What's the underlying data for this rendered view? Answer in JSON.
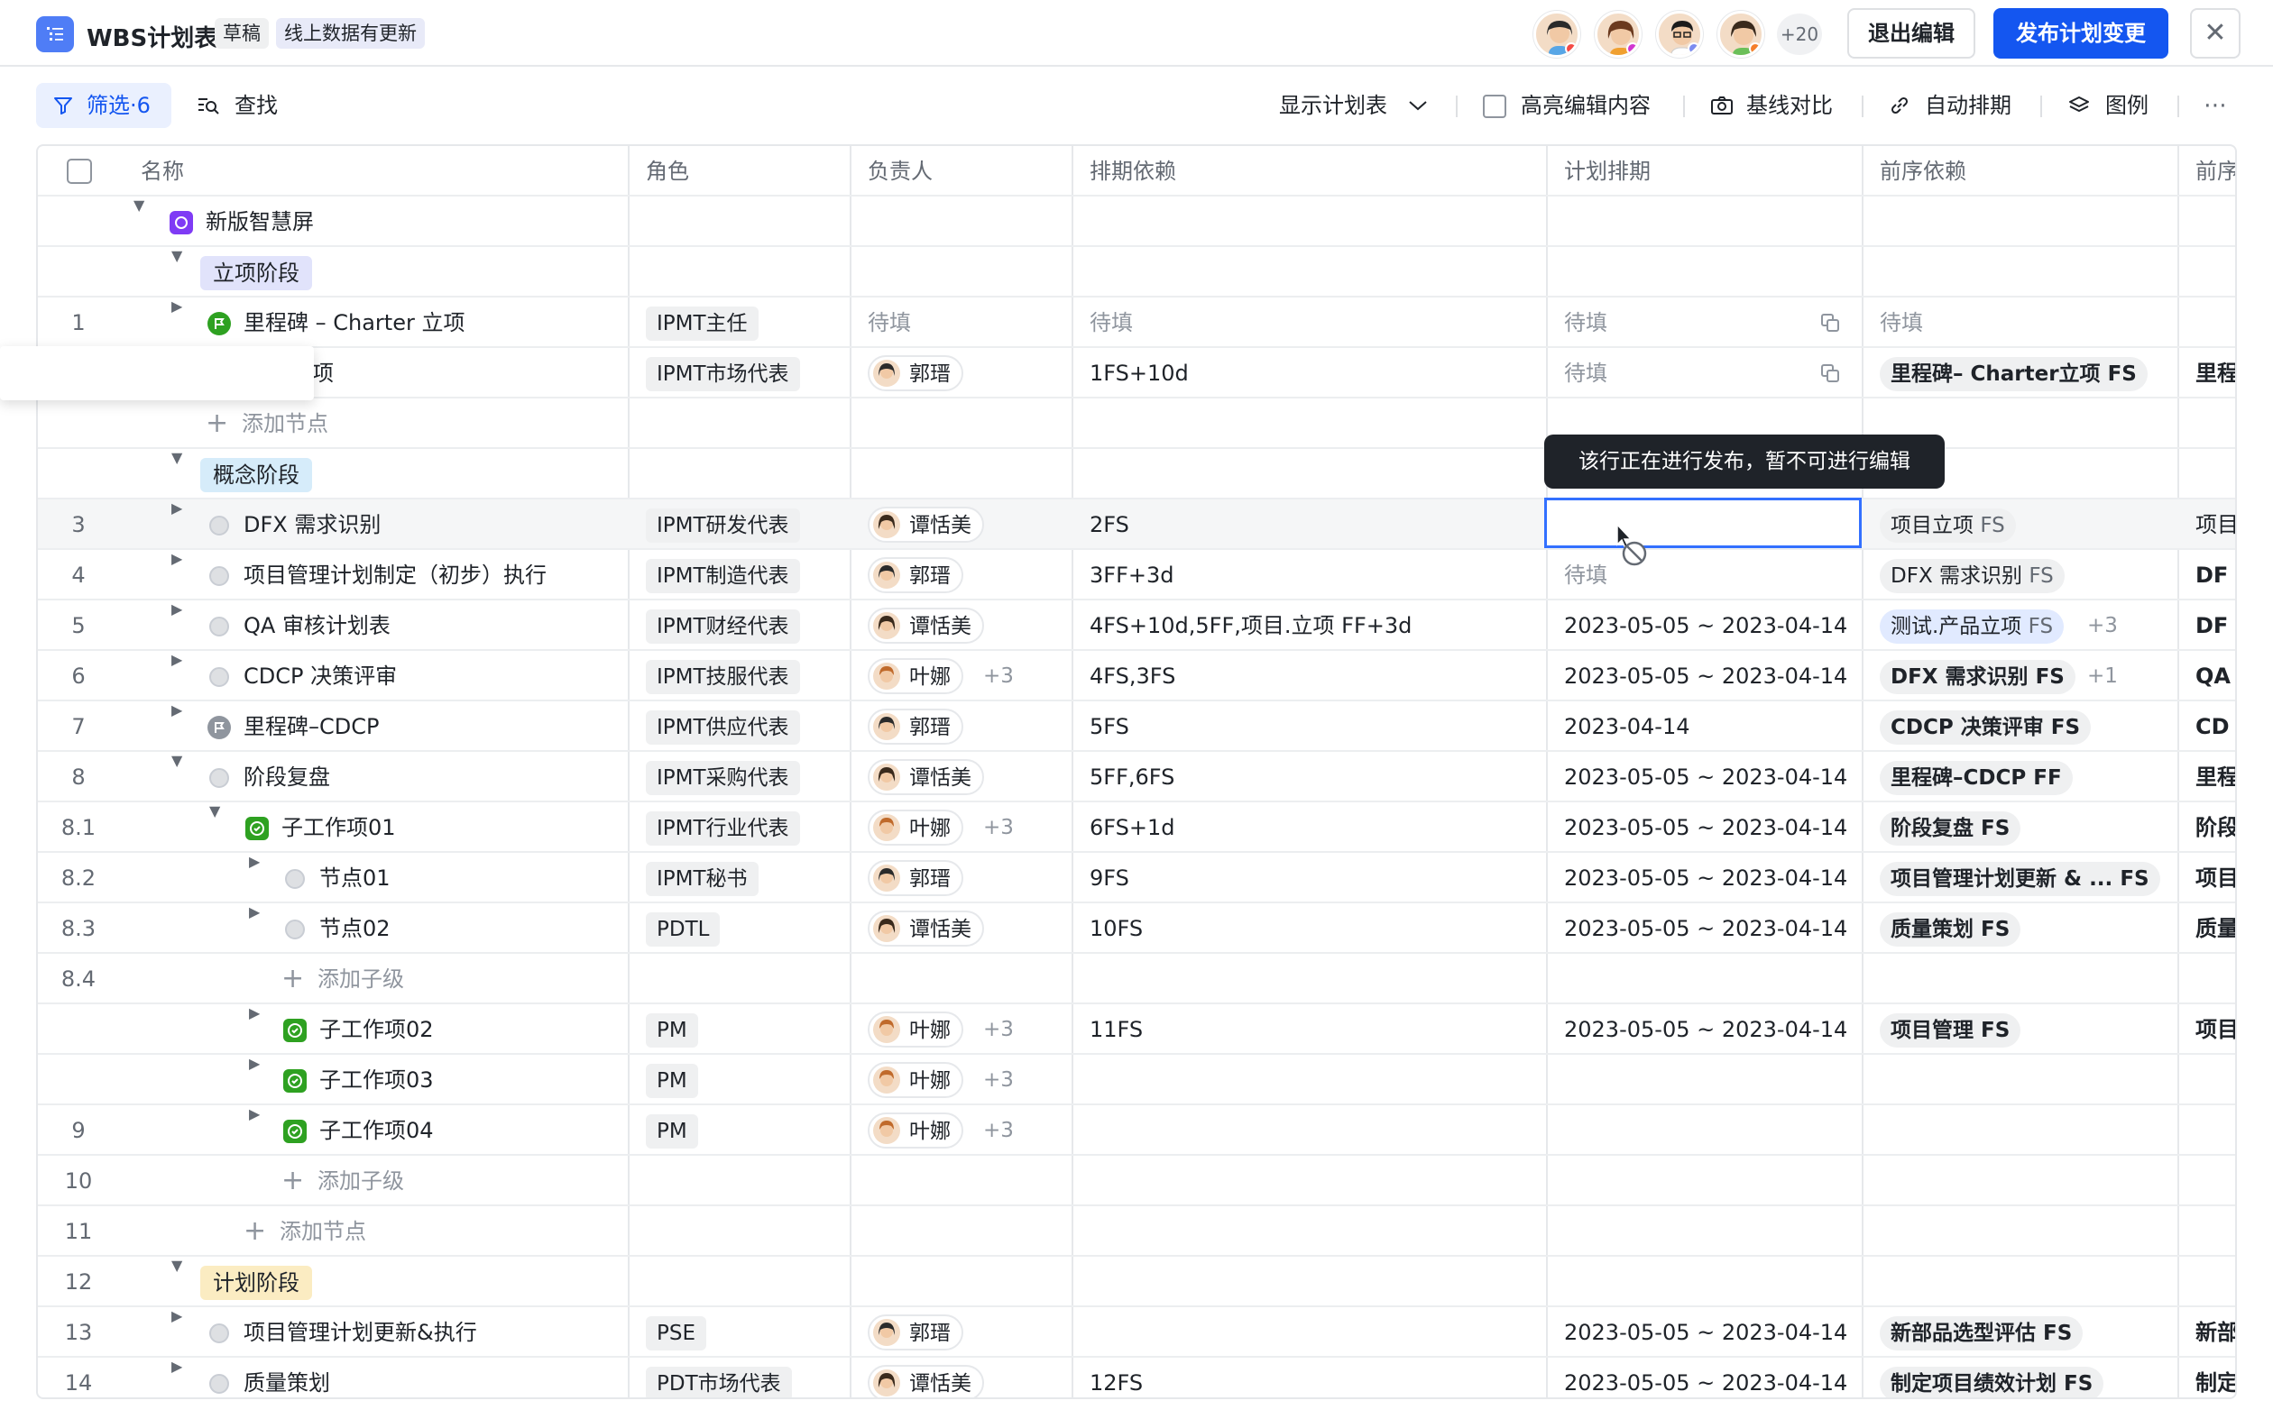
{
  "header": {
    "app_icon": "list-icon",
    "title": "WBS计划表",
    "tag_draft": "草稿",
    "tag_update": "线上数据有更新",
    "collab_more": "+20",
    "exit_label": "退出编辑",
    "publish_label": "发布计划变更",
    "accent": "#1456f0"
  },
  "toolbar": {
    "filter_label": "筛选·6",
    "find_label": "查找",
    "show_plan": "显示计划表",
    "highlight": "高亮编辑内容",
    "baseline": "基线对比",
    "auto_schedule": "自动排期",
    "legend": "图例"
  },
  "columns": {
    "name": "名称",
    "role": "角色",
    "owner": "负责人",
    "sched_dep": "排期依赖",
    "plan": "计划排期",
    "pre_dep": "前序依赖",
    "pre2": "前序"
  },
  "tooltip": "该行正在进行发布，暂不可进行编辑",
  "rows": {
    "r0": {
      "name": "新版智慧屏"
    },
    "r1": {
      "phase": "立项阶段"
    },
    "r2": {
      "num": "1",
      "name": "里程碑 – Charter 立项",
      "role": "IPMT主任",
      "owner": "待填",
      "sched": "待填",
      "plan": "待填",
      "pre": "待填"
    },
    "r3": {
      "name": "项",
      "role": "IPMT市场代表",
      "owner": "郭瑨",
      "sched": "1FS+10d",
      "plan": "待填",
      "pre": "里程碑– Charter立项",
      "pre_fs": "FS",
      "pre2": "里程"
    },
    "r4": {
      "add": "添加节点"
    },
    "r5": {
      "phase": "概念阶段"
    },
    "r6": {
      "num": "3",
      "name": "DFX 需求识别",
      "role": "IPMT研发代表",
      "owner": "谭恬美",
      "sched": "2FS",
      "pre": "项目立项",
      "pre_fs": "FS",
      "pre2": "项目"
    },
    "r7": {
      "num": "4",
      "name": "项目管理计划制定（初步）执行",
      "role": "IPMT制造代表",
      "owner": "郭瑨",
      "sched": "3FF+3d",
      "plan": "待填",
      "pre": "DFX 需求识别",
      "pre_fs": "FS",
      "pre2": "DF"
    },
    "r8": {
      "num": "5",
      "name": "QA 审核计划表",
      "role": "IPMT财经代表",
      "owner": "谭恬美",
      "sched": "4FS+10d,5FF,项目.立项 FF+3d",
      "plan": "2023-05-05 ~ 2023-04-14",
      "pre": "测试.产品立项",
      "pre_fs": "FS",
      "pre_more": "+3",
      "pre2": "DF"
    },
    "r9": {
      "num": "6",
      "name": "CDCP 决策评审",
      "role": "IPMT技服代表",
      "owner": "叶娜",
      "owner_more": "+3",
      "sched": "4FS,3FS",
      "plan": "2023-05-05 ~ 2023-04-14",
      "pre": "DFX 需求识别",
      "pre_fs": "FS",
      "pre_more": "+1",
      "pre2": "QA"
    },
    "r10": {
      "num": "7",
      "name": "里程碑–CDCP",
      "role": "IPMT供应代表",
      "owner": "郭瑨",
      "sched": "5FS",
      "plan": "2023-04-14",
      "pre": "CDCP 决策评审",
      "pre_fs": "FS",
      "pre2": "CD"
    },
    "r11": {
      "num": "8",
      "name": "阶段复盘",
      "role": "IPMT采购代表",
      "owner": "谭恬美",
      "sched": "5FF,6FS",
      "plan": "2023-05-05 ~ 2023-04-14",
      "pre": "里程碑–CDCP",
      "pre_fs": "FF",
      "pre2": "里程"
    },
    "r12": {
      "num": "8.1",
      "name": "子工作项01",
      "role": "IPMT行业代表",
      "owner": "叶娜",
      "owner_more": "+3",
      "sched": "6FS+1d",
      "plan": "2023-05-05 ~ 2023-04-14",
      "pre": "阶段复盘",
      "pre_fs": "FS",
      "pre2": "阶段"
    },
    "r13": {
      "num": "8.2",
      "name": "节点01",
      "role": "IPMT秘书",
      "owner": "郭瑨",
      "sched": "9FS",
      "plan": "2023-05-05 ~ 2023-04-14",
      "pre": "项目管理计划更新 & ...",
      "pre_fs": "FS",
      "pre2": "项目"
    },
    "r14": {
      "num": "8.3",
      "name": "节点02",
      "role": "PDTL",
      "owner": "谭恬美",
      "sched": "10FS",
      "plan": "2023-05-05 ~ 2023-04-14",
      "pre": "质量策划",
      "pre_fs": "FS",
      "pre2": "质量"
    },
    "r15": {
      "num": "8.4",
      "add": "添加子级"
    },
    "r16": {
      "name": "子工作项02",
      "role": "PM",
      "owner": "叶娜",
      "owner_more": "+3",
      "sched": "11FS",
      "plan": "2023-05-05 ~ 2023-04-14",
      "pre": "项目管理",
      "pre_fs": "FS",
      "pre2": "项目"
    },
    "r17": {
      "name": "子工作项03",
      "role": "PM",
      "owner": "叶娜",
      "owner_more": "+3"
    },
    "r18": {
      "num": "9",
      "name": "子工作项04",
      "role": "PM",
      "owner": "叶娜",
      "owner_more": "+3"
    },
    "r19": {
      "num": "10",
      "add": "添加子级"
    },
    "r20": {
      "num": "11",
      "add": "添加节点"
    },
    "r21": {
      "num": "12",
      "phase": "计划阶段"
    },
    "r22": {
      "num": "13",
      "name": "项目管理计划更新&执行",
      "role": "PSE",
      "owner": "郭瑨",
      "plan": "2023-05-05 ~ 2023-04-14",
      "pre": "新部品选型评估",
      "pre_fs": "FS",
      "pre2": "新部"
    },
    "r23": {
      "num": "14",
      "name": "质量策划",
      "role": "PDT市场代表",
      "owner": "谭恬美",
      "sched": "12FS",
      "plan": "2023-05-05 ~ 2023-04-14",
      "pre": "制定项目绩效计划",
      "pre_fs": "FS",
      "pre2": "制定"
    }
  },
  "colors": {
    "phase1": "#e1e3fb",
    "phase2": "#d6ecfa",
    "phase3": "#fbecc2",
    "green": "#2ea121",
    "selection": "#3370ff"
  }
}
